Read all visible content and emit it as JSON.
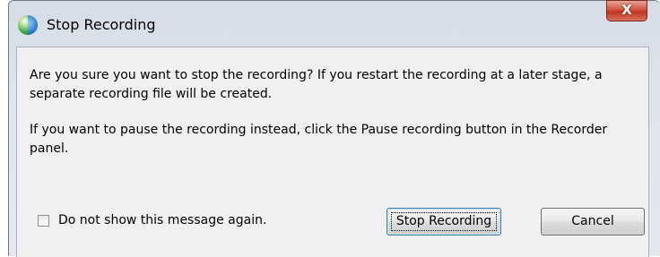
{
  "dialog": {
    "title": "Stop Recording",
    "close_symbol": "X",
    "message_line_1": "Are you sure you want to stop the recording? If you restart the recording at a later stage, a separate recording file will be created.",
    "message_line_2": "If you want to pause the recording instead, click the Pause recording button in the Recorder panel.",
    "checkbox_label": "Do not show this message again.",
    "checkbox_checked": false,
    "primary_button": "Stop Recording",
    "cancel_button": "Cancel"
  },
  "icons": {
    "app": "globe-icon",
    "close": "close-icon"
  },
  "colors": {
    "close_button": "#c2331d",
    "dialog_background": "#f0f0f0",
    "default_button_border": "#3c7fb1"
  }
}
